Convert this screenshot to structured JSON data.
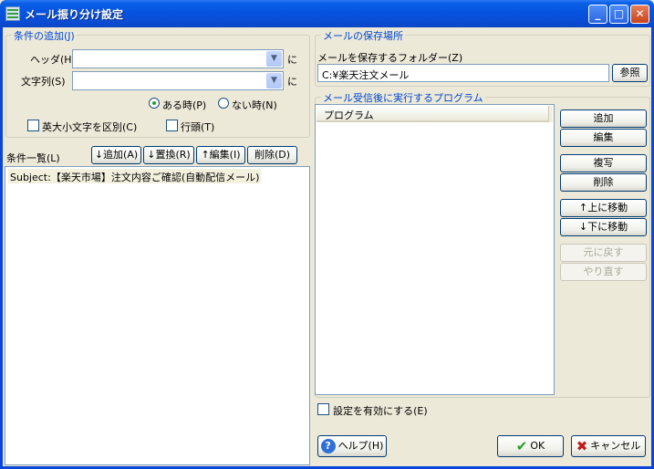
{
  "window": {
    "title": "メール振り分け設定",
    "minimize": "_",
    "maximize": "□",
    "close": "✕"
  },
  "condition_group": {
    "label": "条件の追加(J)",
    "header_label": "ヘッダ(H)",
    "header_value": "",
    "header_suffix": "に",
    "string_label": "文字列(S)",
    "string_value": "",
    "string_suffix": "に",
    "radio_present": "ある時(P)",
    "radio_absent": "ない時(N)",
    "check_case": "英大小文字を区別(C)",
    "check_line_start": "行頭(T)"
  },
  "condition_list": {
    "label": "条件一覧(L)",
    "add_button": "↓追加(A)",
    "replace_button": "↓置換(R)",
    "edit_button": "↑編集(I)",
    "delete_button": "削除(D)",
    "items": [
      "Subject:【楽天市場】注文内容ご確認(自動配信メール)"
    ]
  },
  "storage_group": {
    "label": "メールの保存場所",
    "folder_label": "メールを保存するフォルダー(Z)",
    "folder_value": "C:¥楽天注文メール",
    "browse_button": "参照"
  },
  "program_group": {
    "label": "メール受信後に実行するプログラム",
    "column_header": "プログラム",
    "add_button": "追加",
    "edit_button": "編集",
    "copy_button": "複写",
    "delete_button": "削除",
    "move_up_button": "↑上に移動",
    "move_down_button": "↓下に移動",
    "undo_button": "元に戻す",
    "redo_button": "やり直す"
  },
  "footer": {
    "enable_setting": "設定を有効にする(E)",
    "help_button": "ヘルプ(H)",
    "ok_button": "OK",
    "cancel_button": "キャンセル"
  }
}
